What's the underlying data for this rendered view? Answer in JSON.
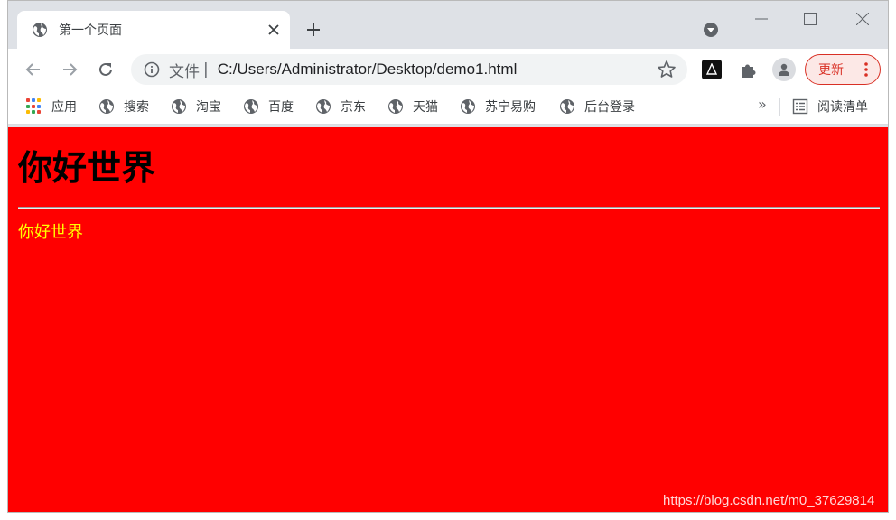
{
  "window": {
    "tab_title": "第一个页面",
    "address": {
      "scheme_label": "文件",
      "url": "C:/Users/Administrator/Desktop/demo1.html"
    },
    "update_label": "更新",
    "bookmarks": [
      {
        "label": "应用",
        "icon": "apps-grid-icon"
      },
      {
        "label": "搜索",
        "icon": "globe-icon"
      },
      {
        "label": "淘宝",
        "icon": "globe-icon"
      },
      {
        "label": "百度",
        "icon": "globe-icon"
      },
      {
        "label": "京东",
        "icon": "globe-icon"
      },
      {
        "label": "天猫",
        "icon": "globe-icon"
      },
      {
        "label": "苏宁易购",
        "icon": "globe-icon"
      },
      {
        "label": "后台登录",
        "icon": "globe-icon"
      }
    ],
    "more_label": "»",
    "reading_list_label": "阅读清单"
  },
  "page": {
    "heading": "你好世界",
    "paragraph": "你好世界",
    "background_color": "#ff0000",
    "paragraph_color": "#ffff00"
  },
  "watermark": "https://blog.csdn.net/m0_37629814"
}
